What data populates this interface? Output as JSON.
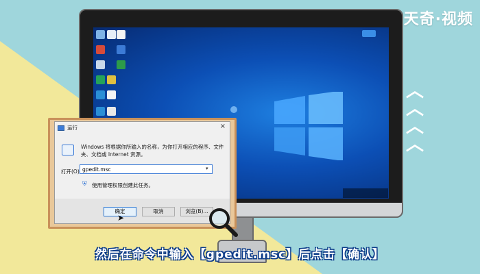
{
  "brand": {
    "logo_text": "天奇·视频"
  },
  "run_dialog": {
    "title": "运行",
    "close_glyph": "×",
    "description": "Windows 将根据你所输入的名称，为你打开相应的程序、文件夹、文档或 Internet 资源。",
    "open_label": "打开(O):",
    "open_value": "gpedit.msc",
    "admin_note": "使用管理权限创建此任务。",
    "buttons": {
      "ok": "确定",
      "cancel": "取消",
      "browse": "浏览(B)..."
    }
  },
  "caption": "然后在命令中输入【gpedit.msc】后点击【确认】",
  "decor": {
    "chevron_glyph": "︿"
  },
  "colors": {
    "background": "#9fd6dc",
    "wedge": "#f2e89a",
    "desktop": "#0c4fb5",
    "caption_outline": "#0e3d8a"
  },
  "icons": [
    "run-icon",
    "shield-icon",
    "magnifier-icon",
    "windows-logo-icon",
    "mouse-cursor-icon"
  ]
}
